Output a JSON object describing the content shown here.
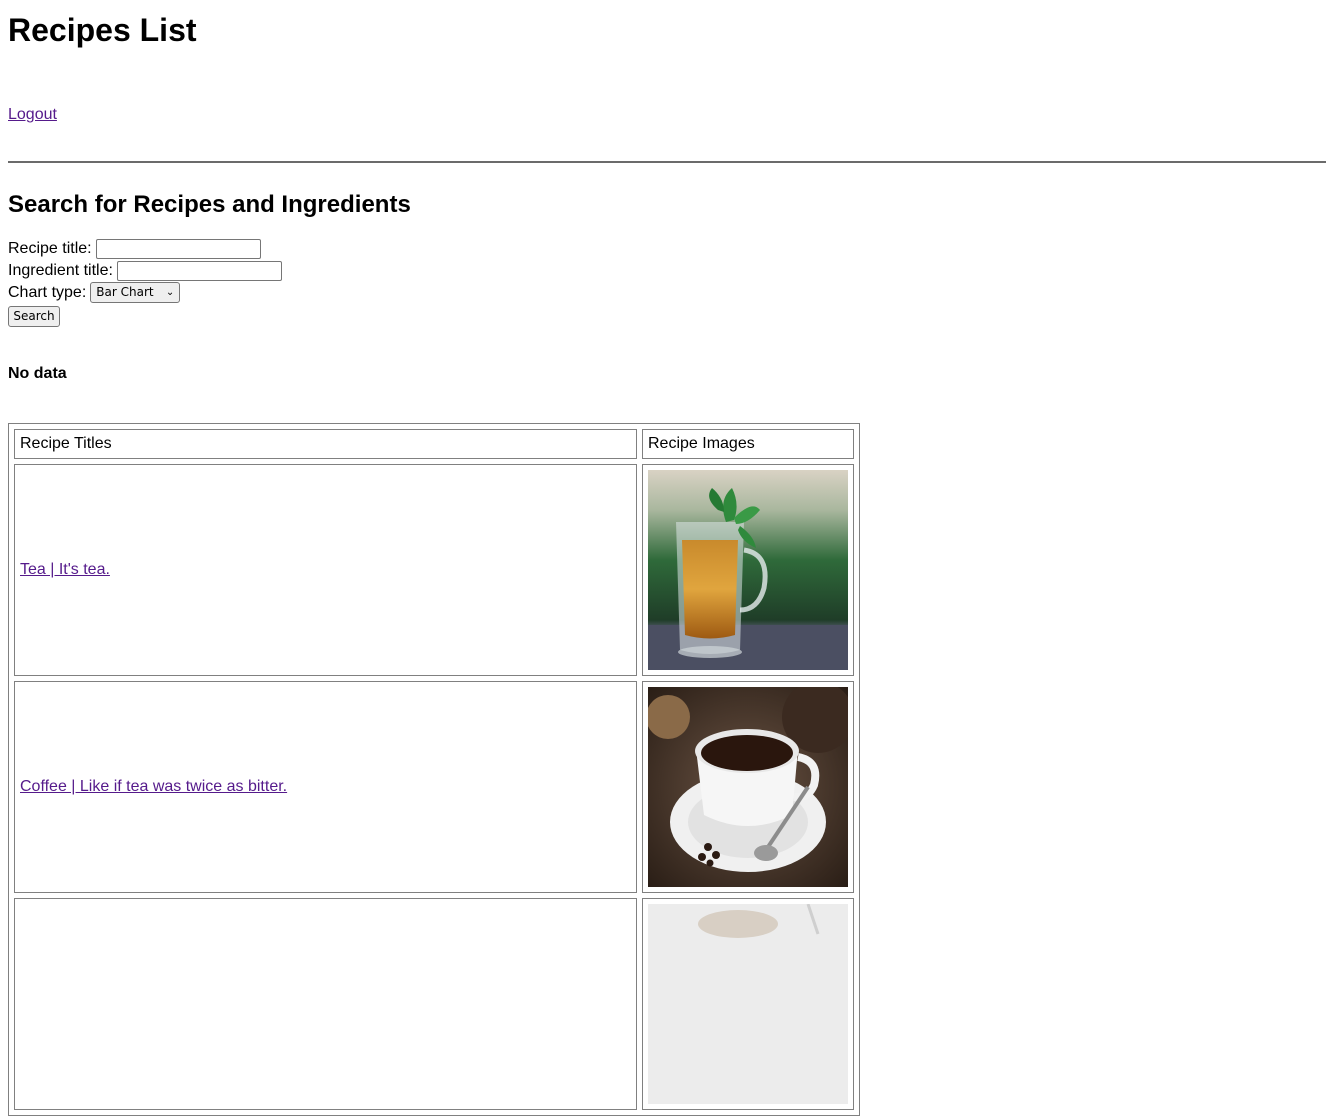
{
  "header": {
    "title": "Recipes List",
    "logout_label": "Logout"
  },
  "search": {
    "heading": "Search for Recipes and Ingredients",
    "recipe_title_label": "Recipe title:",
    "recipe_title_value": "",
    "ingredient_title_label": "Ingredient title:",
    "ingredient_title_value": "",
    "chart_type_label": "Chart type:",
    "chart_type_selected": "Bar Chart",
    "search_button_label": "Search"
  },
  "results": {
    "status": "No data"
  },
  "table": {
    "headers": [
      "Recipe Titles",
      "Recipe Images"
    ],
    "rows": [
      {
        "title": "Tea | It's tea.",
        "image": "tea-glass-photo"
      },
      {
        "title": "Coffee | Like if tea was twice as bitter.",
        "image": "coffee-cup-photo"
      },
      {
        "title": "",
        "image": "partial-photo"
      }
    ]
  },
  "colors": {
    "link": "#551a8b",
    "border": "#808080",
    "divider": "#6b6b6b"
  }
}
